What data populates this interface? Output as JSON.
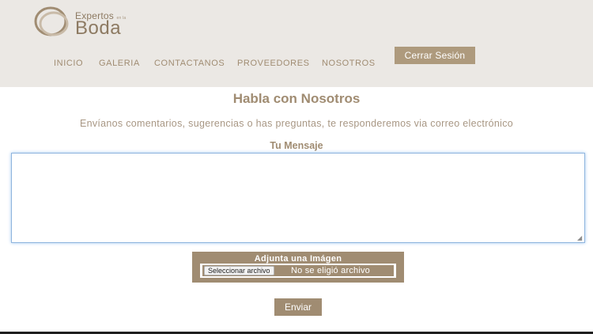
{
  "brand": {
    "top": "Expertos",
    "small": "en la",
    "bottom": "Boda",
    "colors": {
      "accent": "#a08c72",
      "header_bg": "#ebe8e4"
    }
  },
  "nav": {
    "items": [
      {
        "label": "INICIO"
      },
      {
        "label": "GALERIA"
      },
      {
        "label": "CONTACTANOS"
      },
      {
        "label": "PROVEEDORES"
      },
      {
        "label": "NOSOTROS"
      }
    ],
    "logout_label": "Cerrar Sesión"
  },
  "contact": {
    "title": "Habla con Nosotros",
    "subtitle": "Envíanos comentarios, sugerencias o has preguntas, te responderemos via correo electrónico",
    "message_label": "Tu Mensaje",
    "message_value": "",
    "attach_label": "Adjunta una Imágen",
    "file_button": "Seleccionar archivo",
    "file_status": "No se eligió archivo",
    "send_label": "Enviar"
  }
}
